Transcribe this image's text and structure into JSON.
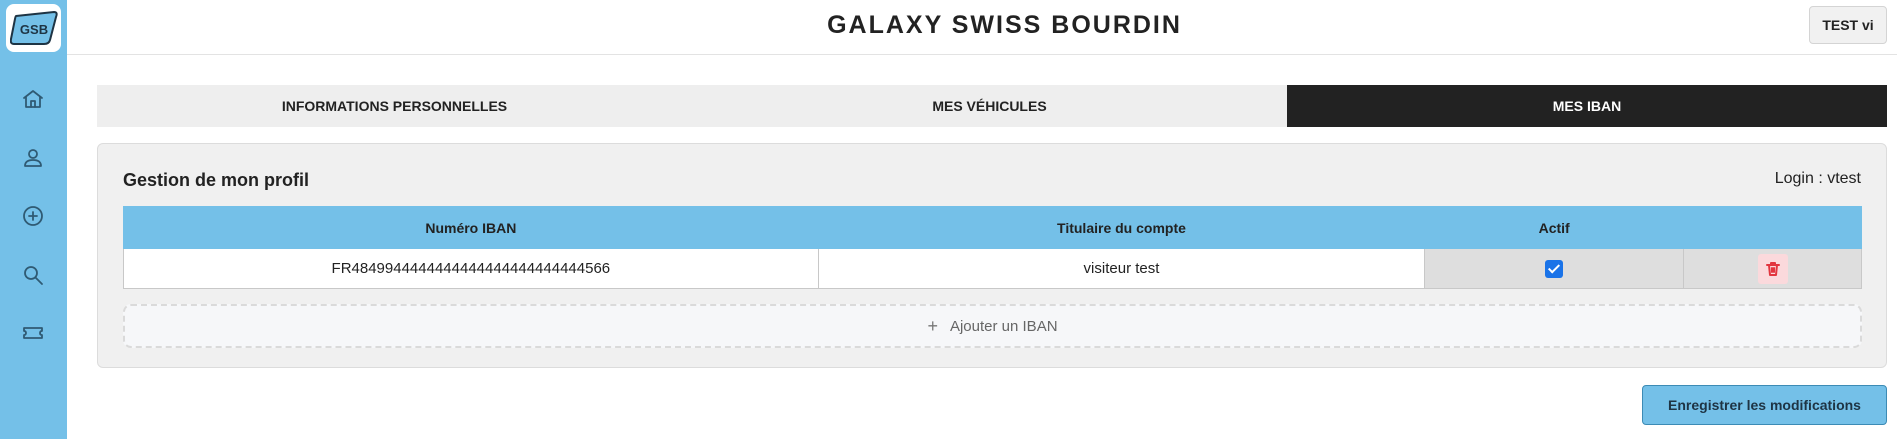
{
  "app": {
    "logo_text": "GSB",
    "brand": "GALAXY SWISS BOURDIN",
    "user_button": "TEST vi"
  },
  "sidebar": {
    "items": [
      {
        "icon": "home-icon"
      },
      {
        "icon": "user-icon"
      },
      {
        "icon": "plus-circle-icon"
      },
      {
        "icon": "search-icon"
      },
      {
        "icon": "ticket-icon"
      }
    ]
  },
  "tabs": [
    {
      "label": "INFORMATIONS PERSONNELLES",
      "active": false
    },
    {
      "label": "MES VÉHICULES",
      "active": false
    },
    {
      "label": "MES IBAN",
      "active": true
    }
  ],
  "card": {
    "title": "Gestion de mon profil",
    "login": "Login : vtest"
  },
  "table": {
    "columns": [
      "Numéro IBAN",
      "Titulaire du compte",
      "Actif",
      ""
    ],
    "rows": [
      {
        "iban": "FR4849944444444444444444444444566",
        "holder": "visiteur test",
        "active": true
      }
    ]
  },
  "add_iban_label": "Ajouter un IBAN",
  "save_label": "Enregistrer les modifications",
  "colors": {
    "sidebar": "#74c0e8",
    "active_tab": "#222222",
    "checkbox": "#1a73e8",
    "delete": "#e2353f"
  }
}
